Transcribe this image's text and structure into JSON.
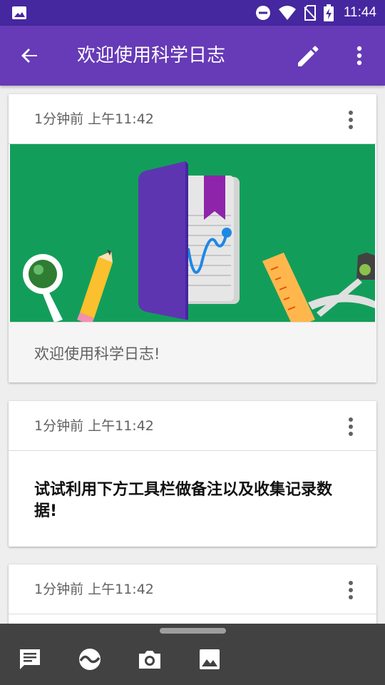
{
  "status_bar": {
    "time": "11:44",
    "icons": [
      "image-icon",
      "do-not-disturb-icon",
      "wifi-icon",
      "no-sim-icon",
      "battery-charging-icon"
    ]
  },
  "app_bar": {
    "title": "欢迎使用科学日志",
    "icons": [
      "back-arrow-icon",
      "edit-pencil-icon",
      "more-vertical-icon"
    ]
  },
  "cards": [
    {
      "timestamp": "1分钟前 上午11:42",
      "caption": "欢迎使用科学日志!"
    },
    {
      "timestamp": "1分钟前 上午11:42",
      "body": "试试利用下方工具栏做备注以及收集记录数据!"
    },
    {
      "timestamp": "1分钟前 上午11:42"
    }
  ],
  "toolbar": {
    "tools": [
      "note-icon",
      "sensor-wave-icon",
      "camera-icon",
      "gallery-image-icon"
    ],
    "active": "note-icon"
  },
  "colors": {
    "status_bar": "#4527a0",
    "app_bar": "#673ab7",
    "image_background": "#129e5a",
    "toolbar": "#424242"
  }
}
